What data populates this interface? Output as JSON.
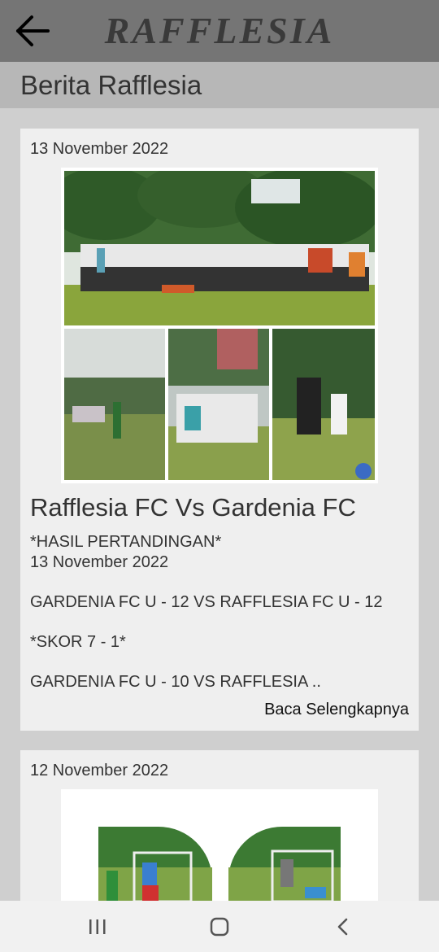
{
  "header": {
    "brand": "RAFFLESIA",
    "back_icon": "arrow-left-icon"
  },
  "page": {
    "title": "Berita Rafflesia"
  },
  "posts": [
    {
      "date": "13 November 2022",
      "title": "Rafflesia FC Vs Gardenia FC",
      "excerpt": "*HASIL PERTANDINGAN*\n13 November 2022\n\nGARDENIA FC U - 12 VS RAFFLESIA FC U - 12\n\n*SKOR 7 - 1*\n\nGARDENIA FC U - 10 VS RAFFLESIA ..",
      "read_more": "Baca Selengkapnya"
    },
    {
      "date": "12 November 2022"
    }
  ],
  "navbar": {
    "recents_icon": "recents-icon",
    "home_icon": "home-icon",
    "back_icon": "nav-back-icon"
  }
}
